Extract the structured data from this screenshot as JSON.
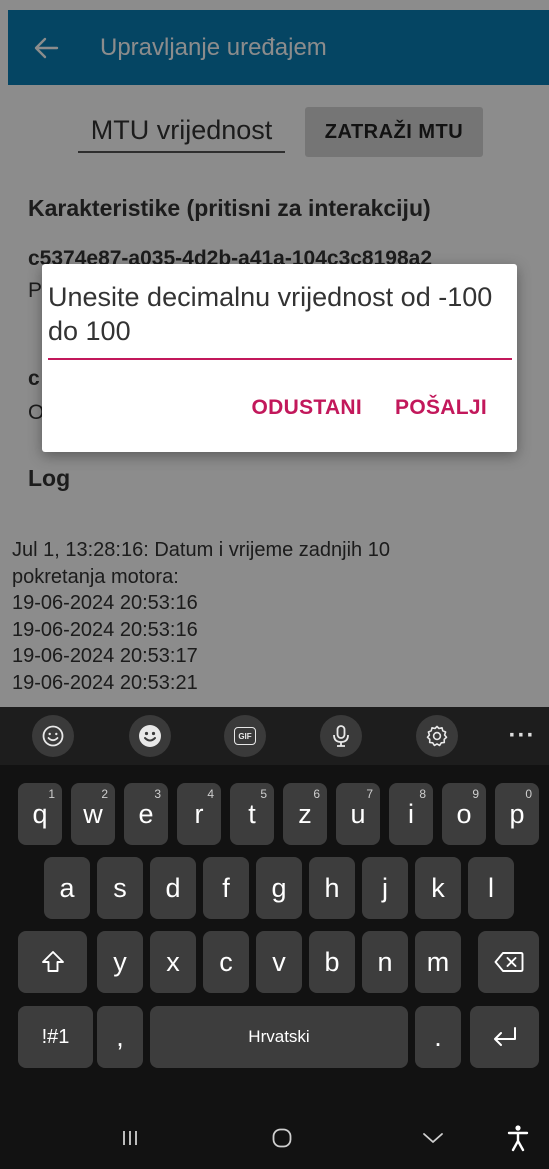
{
  "app": {
    "title": "Upravljanje uređajem",
    "mtu_field_value": "MTU vrijednost",
    "mtu_button_label": "ZATRAŽI MTU",
    "characteristics_heading": "Karakteristike (pritisni za interakciju)",
    "char_uuid": "c5374e87-a035-4d2b-a41a-104c3c8198a2",
    "char_letters": [
      "P",
      "c",
      "O"
    ],
    "log_heading": "Log",
    "log_lines": [
      "Jul 1, 13:28:16: Datum i vrijeme zadnjih 10",
      "pokretanja motora:",
      "19-06-2024 20:53:16",
      "19-06-2024 20:53:16",
      "19-06-2024 20:53:17",
      "19-06-2024 20:53:21"
    ]
  },
  "dialog": {
    "input_text": "Unesite decimalnu vrijednost od -100 do 100",
    "cancel_label": "ODUSTANI",
    "send_label": "POŠALJI",
    "accent_color": "#c2185b"
  },
  "keyboard": {
    "toolbar_icons": [
      "emoji-face-icon",
      "sticker-icon",
      "gif-icon",
      "microphone-icon",
      "settings-icon",
      "more-icon"
    ],
    "gif_label": "GIF",
    "more_label": "···",
    "row1": [
      {
        "key": "q",
        "hint": "1"
      },
      {
        "key": "w",
        "hint": "2"
      },
      {
        "key": "e",
        "hint": "3"
      },
      {
        "key": "r",
        "hint": "4"
      },
      {
        "key": "t",
        "hint": "5"
      },
      {
        "key": "z",
        "hint": "6"
      },
      {
        "key": "u",
        "hint": "7"
      },
      {
        "key": "i",
        "hint": "8"
      },
      {
        "key": "o",
        "hint": "9"
      },
      {
        "key": "p",
        "hint": "0"
      }
    ],
    "row2": [
      "a",
      "s",
      "d",
      "f",
      "g",
      "h",
      "j",
      "k",
      "l"
    ],
    "row3": [
      "y",
      "x",
      "c",
      "v",
      "b",
      "n",
      "m"
    ],
    "symbols_label": "!#1",
    "comma_label": ",",
    "space_label": "Hrvatski",
    "period_label": "."
  }
}
